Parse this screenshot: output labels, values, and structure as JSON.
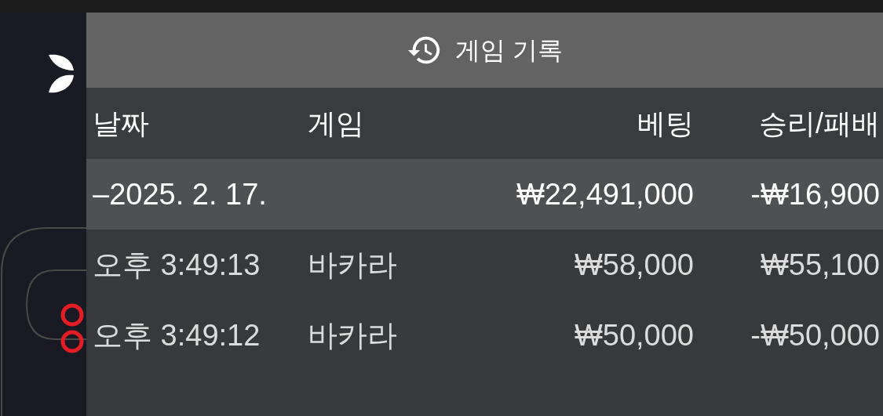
{
  "panel": {
    "title": "게임 기록"
  },
  "table": {
    "columns": [
      "날짜",
      "게임",
      "베팅",
      "승리/패배"
    ],
    "group": {
      "date": "–2025. 2. 17.",
      "bet": "₩22,491,000",
      "result": "-₩16,900"
    },
    "rows": [
      {
        "time": "오후 3:49:13",
        "game": "바카라",
        "bet": "₩58,000",
        "result": "₩55,100"
      },
      {
        "time": "오후 3:49:12",
        "game": "바카라",
        "bet": "₩50,000",
        "result": "-₩50,000"
      }
    ]
  }
}
